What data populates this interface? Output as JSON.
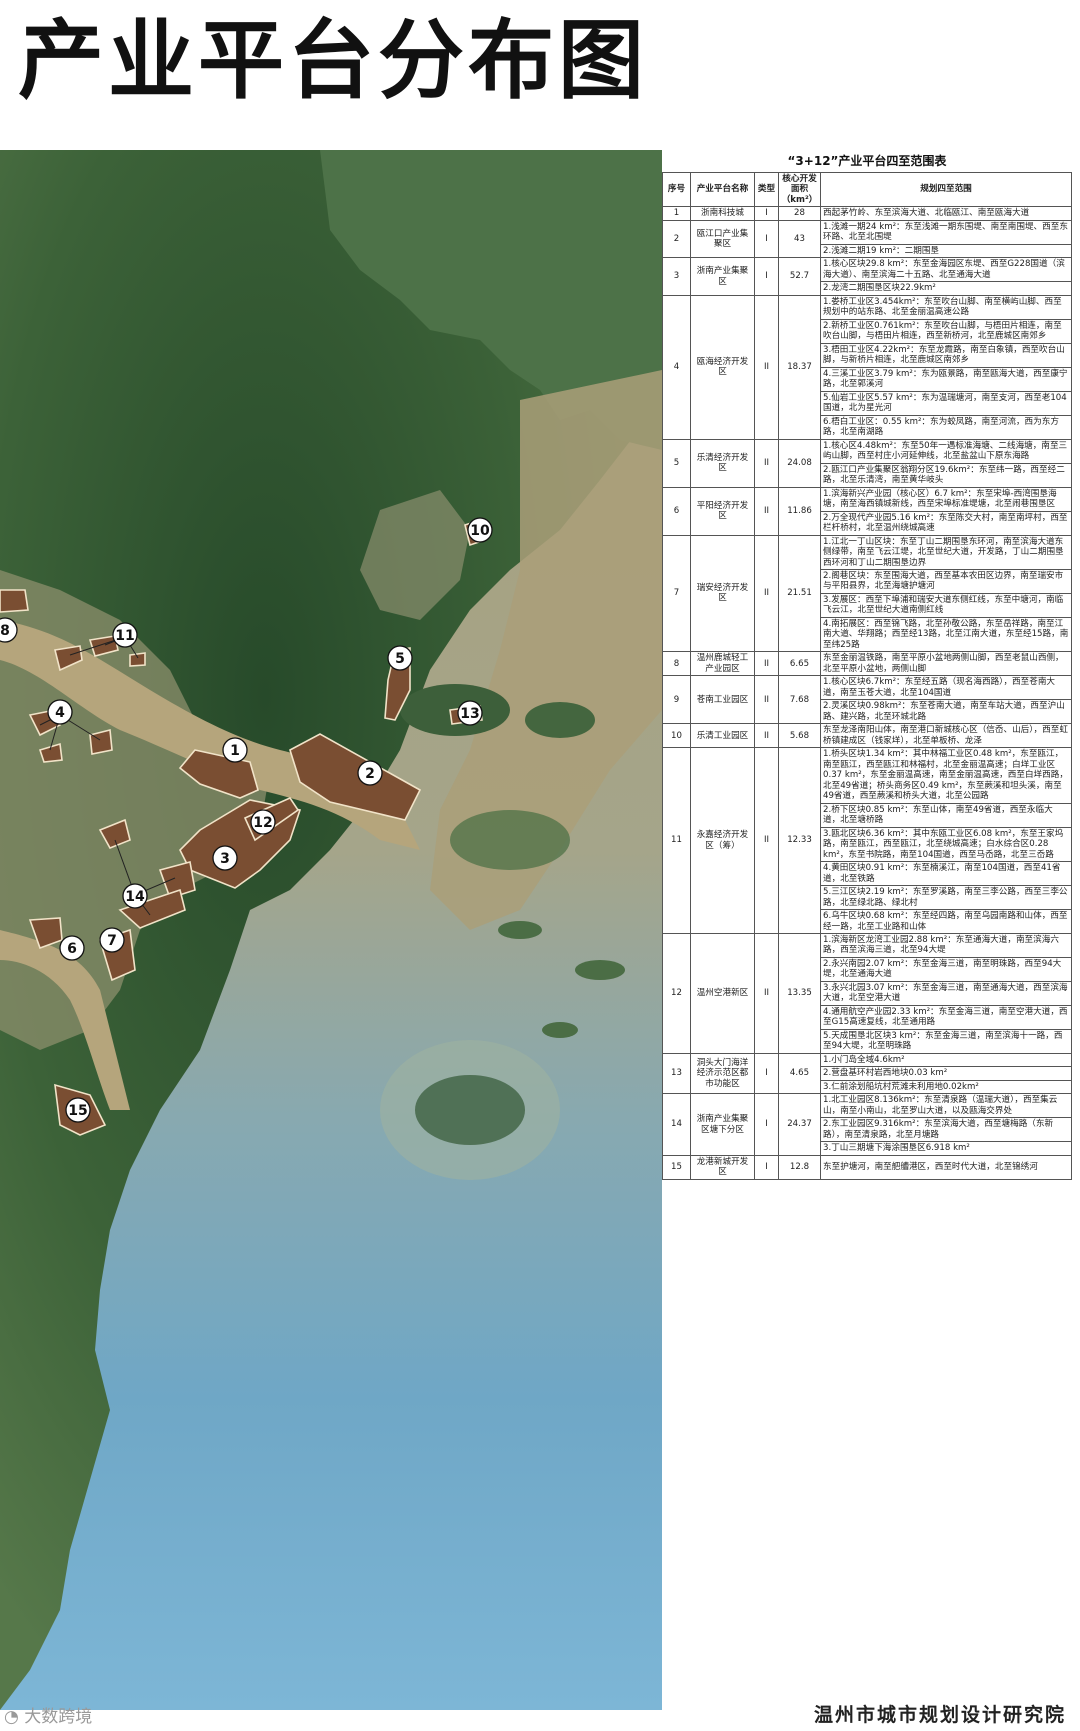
{
  "page_title": "产业平台分布图",
  "watermark": "大数跨境",
  "institute": "温州市城市规划设计研究院",
  "map": {
    "zones": [
      {
        "label": "1"
      },
      {
        "label": "2"
      },
      {
        "label": "3"
      },
      {
        "label": "4"
      },
      {
        "label": "5"
      },
      {
        "label": "6"
      },
      {
        "label": "7"
      },
      {
        "label": "8"
      },
      {
        "label": "10"
      },
      {
        "label": "11"
      },
      {
        "label": "12"
      },
      {
        "label": "13"
      },
      {
        "label": "14"
      },
      {
        "label": "15"
      }
    ]
  },
  "table": {
    "caption": "“3+12”产业平台四至范围表",
    "headers": [
      "序号",
      "产业平台名称",
      "类型",
      "核心开发面积（km²）",
      "规划四至范围"
    ],
    "rows": [
      {
        "no": "1",
        "name": "浙南科技城",
        "type": "I",
        "area": "28",
        "ranges": [
          "西起茅竹岭、东至滨海大道、北临瓯江、南至瓯海大道"
        ]
      },
      {
        "no": "2",
        "name": "瓯江口产业集聚区",
        "type": "I",
        "area": "43",
        "ranges": [
          "1.浅滩一期24 km²：东至浅滩一期东围堤、南至南围堤、西至东环路、北至北围堤",
          "2.浅滩二期19 km²：二期围垦"
        ]
      },
      {
        "no": "3",
        "name": "浙南产业集聚区",
        "type": "I",
        "area": "52.7",
        "ranges": [
          "1.核心区块29.8 km²：东至金海园区东堤、西至G228国道（滨海大道）、南至滨海二十五路、北至通海大道",
          "2.龙湾二期围垦区块22.9km²"
        ]
      },
      {
        "no": "4",
        "name": "瓯海经济开发区",
        "type": "II",
        "area": "18.37",
        "ranges": [
          "1.娄桥工业区3.454km²：东至吹台山脚、南至横屿山脚、西至规划中的站东路、北至金丽温高速公路",
          "2.新桥工业区0.761km²：东至吹台山脚，与梧田片相连，南至吹台山脚，与梧田片相连，西至新桥河，北至鹿城区南郊乡",
          "3.梧田工业区4.22km²：东至龙霞路，南至白象镇，西至吹台山脚，与新桥片相连，北至鹿城区南郊乡",
          "4.三溪工业区3.79 km²：东为瓯景路，南至瓯海大道，西至康宁路，北至郭溪河",
          "5.仙岩工业区5.57 km²：东为温瑞塘河，南至支河，西至老104国道，北为星光河",
          "6.梧白工业区：0.55 km²：东为蛟凤路，南至河流，西为东方路，北至南湖路"
        ]
      },
      {
        "no": "5",
        "name": "乐清经济开发区",
        "type": "II",
        "area": "24.08",
        "ranges": [
          "1.核心区4.48km²：东至50年一遇标准海塘、二线海塘，南至三屿山脚，西至村庄小河延伸线，北至盐盆山下原东海路",
          "2.瓯江口产业集聚区翁翔分区19.6km²：东至纬一路，西至经二路，北至乐清湾，南至黄华岐头"
        ]
      },
      {
        "no": "6",
        "name": "平阳经济开发区",
        "type": "II",
        "area": "11.86",
        "ranges": [
          "1.滨海新兴产业园（核心区）6.7 km²：东至宋埠-西湾围垦海塘，南至海西镇城新线，西至宋埠标准堤塘，北至闹巷围垦区",
          "2.万全现代产业园5.16 km²：东至陈交大村，南至南坪村，西至栏杆桥村，北至温州绕城高速"
        ]
      },
      {
        "no": "7",
        "name": "瑞安经济开发区",
        "type": "II",
        "area": "21.51",
        "ranges": [
          "1.江北一丁山区块：东至丁山二期围垦东环河，南至滨海大道东侧绿带，南至飞云江堤，北至世纪大道，开发路，丁山二期围垦西环河和丁山二期围垦边界",
          "2.阁巷区块：东至围海大道，西至基本农田区边界，南至瑞安市与平阳县界，北至海塘护塘河",
          "3.发展区：西至下埠浦和瑞安大道东侧红线，东至中塘河，南临飞云江，北至世纪大道南侧红线",
          "4.南拓展区：西至锦飞路，北至孙敬公路，东至岳祥路，南至江南大道、华翔路；西至经13路，北至江南大道，东至经15路，南至纬25路"
        ]
      },
      {
        "no": "8",
        "name": "温州鹿城轻工产业园区",
        "type": "II",
        "area": "6.65",
        "ranges": [
          "东至金丽温铁路，南至平原小盆地两侧山脚，西至老鼠山西侧，北至平原小盆地，两侧山脚"
        ]
      },
      {
        "no": "9",
        "name": "苍南工业园区",
        "type": "II",
        "area": "7.68",
        "ranges": [
          "1.核心区块6.7km²：东至经五路（现名海西路），西至苍南大道，南至玉苍大道，北至104国道",
          "2.灵溪区块0.98km²：东至苍南大道，南至车站大道，西至沪山路、建兴路，北至环城北路"
        ]
      },
      {
        "no": "10",
        "name": "乐清工业园区",
        "type": "II",
        "area": "5.68",
        "ranges": [
          "东至龙泽南阳山体，南至港口新城核心区（信岙、山后），西至虹桥镇建成区（钱家垟），北至单板桥、龙泽"
        ]
      },
      {
        "no": "11",
        "name": "永嘉经济开发区（筹）",
        "type": "II",
        "area": "12.33",
        "ranges": [
          "1.桥头区块1.34 km²：其中林福工业区0.48 km²，东至瓯江，南至瓯江，西至瓯江和林福村，北至金丽温高速；白垟工业区0.37 km²，东至金丽温高速，南至金丽温高速，西至白垟西路，北至49省道；桥头商务区0.49 km²，东至蕨溪和坦头溪，南至49省道，西至蕨溪和桥头大道，北至公园路",
          "2.桥下区块0.85 km²：东至山体，南至49省道，西至永临大道，北至塘桥路",
          "3.瓯北区块6.36 km²：其中东瓯工业区6.08 km²，东至王家坞路，南至瓯江，西至瓯江，北至绕城高速；白水综合区0.28 km²，东至书院路，南至104国道，西至马岙路，北至三岙路",
          "4.黄田区块0.91 km²：东至楠溪江，南至104国道，西至41省道，北至铁路",
          "5.三江区块2.19 km²：东至罗溪路，南至三李公路，西至三李公路，北至绿北路、绿北村",
          "6.乌牛区块0.68 km²：东至经四路，南至乌园南路和山体，西至经一路，北至工业路和山体"
        ]
      },
      {
        "no": "12",
        "name": "温州空港新区",
        "type": "II",
        "area": "13.35",
        "ranges": [
          "1.滨海新区龙湾工业园2.88 km²：东至通海大道，南至滨海六路，西至滨海三道，北至94大堤",
          "2.永兴南园2.07 km²：东至金海三道，南至明珠路，西至94大堤，北至通海大道",
          "3.永兴北园3.07 km²：东至金海三道，南至通海大道，西至滨海大道，北至空港大道",
          "4.通用航空产业园2.33 km²：东至金海三道，南至空港大道，西至G15高速复线，北至通用路",
          "5.天成围垦北区块3 km²：东至金海三道，南至滨海十一路，西至94大堤，北至明珠路"
        ]
      },
      {
        "no": "13",
        "name": "洞头大门海洋经济示范区都市功能区",
        "type": "I",
        "area": "4.65",
        "ranges": [
          "1.小门岛全域4.6km²",
          "2.营盘基环村岩西地块0.03 km²",
          "3.仁前涂划船坑村荒滩未利用地0.02km²"
        ]
      },
      {
        "no": "14",
        "name": "浙南产业集聚区塘下分区",
        "type": "I",
        "area": "24.37",
        "ranges": [
          "1.北工业园区8.136km²：东至清泉路（温瑞大道），西至集云山，南至小南山，北至罗山大道，以及瓯海交界处",
          "2.东工业园区9.316km²：东至滨海大道，西至塘梅路（东新路），南至清泉路，北至月塘路",
          "3.丁山三期塘下海涂围垦区6.918 km²"
        ]
      },
      {
        "no": "15",
        "name": "龙港新城开发区",
        "type": "I",
        "area": "12.8",
        "ranges": [
          "东至护塘河，南至舥艚港区，西至时代大道，北至锦绣河"
        ]
      }
    ]
  }
}
